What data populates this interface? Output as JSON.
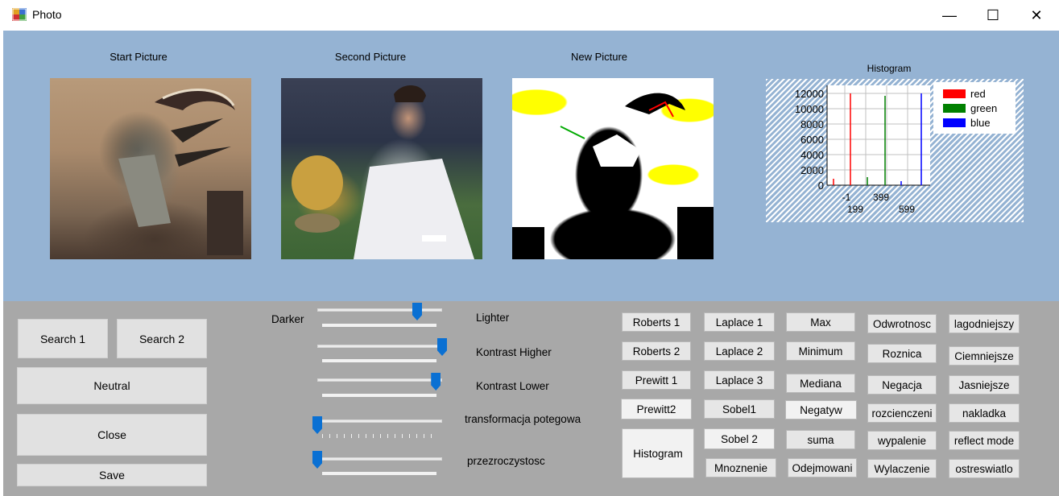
{
  "window": {
    "title": "Photo",
    "minimize": "—",
    "maximize": "☐",
    "close": "✕"
  },
  "pictures": {
    "start_label": "Start Picture",
    "second_label": "Second Picture",
    "new_label": "New Picture"
  },
  "histogram": {
    "title": "Histogram",
    "legend": [
      {
        "name": "red",
        "color": "#ff0000"
      },
      {
        "name": "green",
        "color": "#008000"
      },
      {
        "name": "blue",
        "color": "#0000ff"
      }
    ],
    "y_ticks": [
      "12000",
      "10000",
      "8000",
      "6000",
      "4000",
      "2000",
      "0"
    ],
    "x_ticks_row1": [
      "-1",
      "399"
    ],
    "x_ticks_row2": [
      "199",
      "599"
    ]
  },
  "left_buttons": {
    "search1": "Search 1",
    "search2": "Search 2",
    "neutral": "Neutral",
    "close": "Close",
    "save": "Save"
  },
  "trackbars": {
    "darker": "Darker",
    "lighter": "Lighter",
    "kontrast_higher": "Kontrast Higher",
    "kontrast_lower": "Kontrast Lower",
    "transformacja": "transformacja potegowa",
    "przezroczystosc": "przezroczystosc",
    "levels": {
      "brightness": 0.8,
      "kontrast_higher": 1.0,
      "kontrast_lower": 0.95,
      "transformacja": 0.0,
      "przezroczystosc": 0.0
    }
  },
  "filters": {
    "col1": [
      "Roberts 1",
      "Roberts 2",
      "Prewitt 1",
      "Prewitt2"
    ],
    "histogram": "Histogram",
    "col2": [
      "Laplace 1",
      "Laplace 2",
      "Laplace 3",
      "Sobel1",
      "Sobel 2",
      "Mnoznenie"
    ],
    "col3": [
      "Max",
      "Minimum",
      "Mediana",
      "Negatyw",
      "suma",
      "Odejmowani"
    ],
    "col4": [
      "Odwrotnosc",
      "Roznica",
      "Negacja",
      "rozcienczeni",
      "wypalenie",
      "Wylaczenie"
    ],
    "col5": [
      "lagodniejszy",
      "Ciemniejsze",
      "Jasniejsze",
      "nakladka",
      "reflect mode",
      "ostreswiatlo"
    ]
  }
}
